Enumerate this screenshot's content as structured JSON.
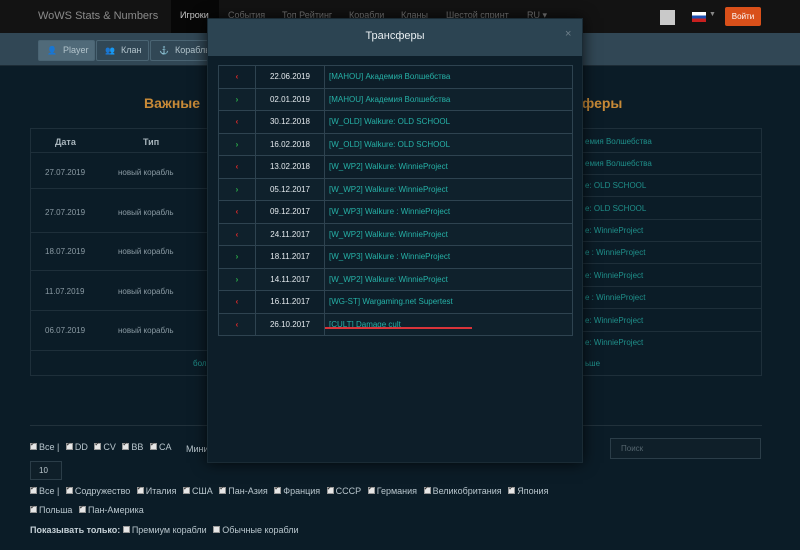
{
  "navbar": {
    "brand": "WoWS Stats & Numbers",
    "items": [
      "Игроки",
      "События",
      "Топ Рейтинг",
      "Корабли",
      "Кланы",
      "Шестой спринт",
      "RU ▾"
    ],
    "active_index": 0,
    "login_label": "Войти"
  },
  "subnav": {
    "tabs": [
      {
        "label": "Player",
        "icon": "user-icon",
        "glyph": "👤"
      },
      {
        "label": "Клан",
        "icon": "group-icon",
        "glyph": "👥"
      },
      {
        "label": "Корабль",
        "icon": "ship-icon",
        "glyph": "⚓"
      }
    ]
  },
  "background": {
    "section_left_title": "Важные",
    "section_right_title": "феры",
    "table_headers": [
      "Дата",
      "Тип"
    ],
    "rows": [
      {
        "date": "27.07.2019",
        "type": "новый корабль"
      },
      {
        "date": "27.07.2019",
        "type": "новый корабль"
      },
      {
        "date": "18.07.2019",
        "type": "новый корабль"
      },
      {
        "date": "11.07.2019",
        "type": "новый корабль"
      },
      {
        "date": "06.07.2019",
        "type": "новый корабль"
      }
    ],
    "right_rows": [
      "емия Волшебства",
      "емия Волшебства",
      "e: OLD SCHOOL",
      "e: OLD SCHOOL",
      "e: WinnieProject",
      "e : WinnieProject",
      "e: WinnieProject",
      "e : WinnieProject",
      "e: WinnieProject",
      "e: WinnieProject",
      "e: WinnieProject",
      "e: WinnieProject"
    ],
    "more_left": "бол",
    "more_right": "ьше"
  },
  "filters": {
    "tiers_line": [
      {
        "label": "Все",
        "checked": true,
        "sep": " |"
      },
      {
        "label": "DD",
        "checked": true
      },
      {
        "label": "CV",
        "checked": true
      },
      {
        "label": "BB",
        "checked": true
      },
      {
        "label": "CA",
        "checked": true
      }
    ],
    "min_label": "Мини",
    "min_value": "10",
    "search_placeholder": "Поиск",
    "nations": [
      {
        "label": "Все",
        "checked": true,
        "sep": " |"
      },
      {
        "label": "Содружество",
        "checked": true
      },
      {
        "label": "Италия",
        "checked": true
      },
      {
        "label": "США",
        "checked": true
      },
      {
        "label": "Пан-Азия",
        "checked": true
      },
      {
        "label": "Франция",
        "checked": true
      },
      {
        "label": "СССР",
        "checked": true
      },
      {
        "label": "Германия",
        "checked": true
      },
      {
        "label": "Великобритания",
        "checked": true
      },
      {
        "label": "Япония",
        "checked": true
      }
    ],
    "nations2": [
      {
        "label": "Польша",
        "checked": true
      },
      {
        "label": "Пан-Америка",
        "checked": true
      }
    ],
    "show_only_label": "Показывать только:",
    "show_only": [
      {
        "label": "Премиум корабли",
        "checked": false
      },
      {
        "label": "Обычные корабли",
        "checked": false
      }
    ]
  },
  "modal": {
    "title": "Трансферы",
    "close_label": "×",
    "transfers": [
      {
        "direction": "out",
        "arrow": "‹",
        "date": "22.06.2019",
        "clan": "[MAHOU] Академия Волшебства"
      },
      {
        "direction": "in",
        "arrow": "›",
        "date": "02.01.2019",
        "clan": "[MAHOU] Академия Волшебства"
      },
      {
        "direction": "out",
        "arrow": "‹",
        "date": "30.12.2018",
        "clan": "[W_OLD] Walkure: OLD SCHOOL"
      },
      {
        "direction": "in",
        "arrow": "›",
        "date": "16.02.2018",
        "clan": "[W_OLD] Walkure: OLD SCHOOL"
      },
      {
        "direction": "out",
        "arrow": "‹",
        "date": "13.02.2018",
        "clan": "[W_WP2] Walkure: WinnieProject"
      },
      {
        "direction": "in",
        "arrow": "›",
        "date": "05.12.2017",
        "clan": "[W_WP2] Walkure: WinnieProject"
      },
      {
        "direction": "out",
        "arrow": "‹",
        "date": "09.12.2017",
        "clan": "[W_WP3] Walkure : WinnieProject"
      },
      {
        "direction": "out",
        "arrow": "‹",
        "date": "24.11.2017",
        "clan": "[W_WP2] Walkure: WinnieProject"
      },
      {
        "direction": "in",
        "arrow": "›",
        "date": "18.11.2017",
        "clan": "[W_WP3] Walkure : WinnieProject"
      },
      {
        "direction": "in",
        "arrow": "›",
        "date": "14.11.2017",
        "clan": "[W_WP2] Walkure: WinnieProject"
      },
      {
        "direction": "out",
        "arrow": "‹",
        "date": "16.11.2017",
        "clan": "[WG-ST] Wargaming.net Supertest"
      },
      {
        "direction": "out",
        "arrow": "‹",
        "date": "26.10.2017",
        "clan": "[CULT] Damage cult"
      }
    ]
  },
  "colors": {
    "accent": "#d9501a",
    "link": "#26b1a7",
    "out_arrow": "#e32a2a",
    "in_arrow": "#2db34a",
    "highlight_underline": "#d9343a"
  }
}
